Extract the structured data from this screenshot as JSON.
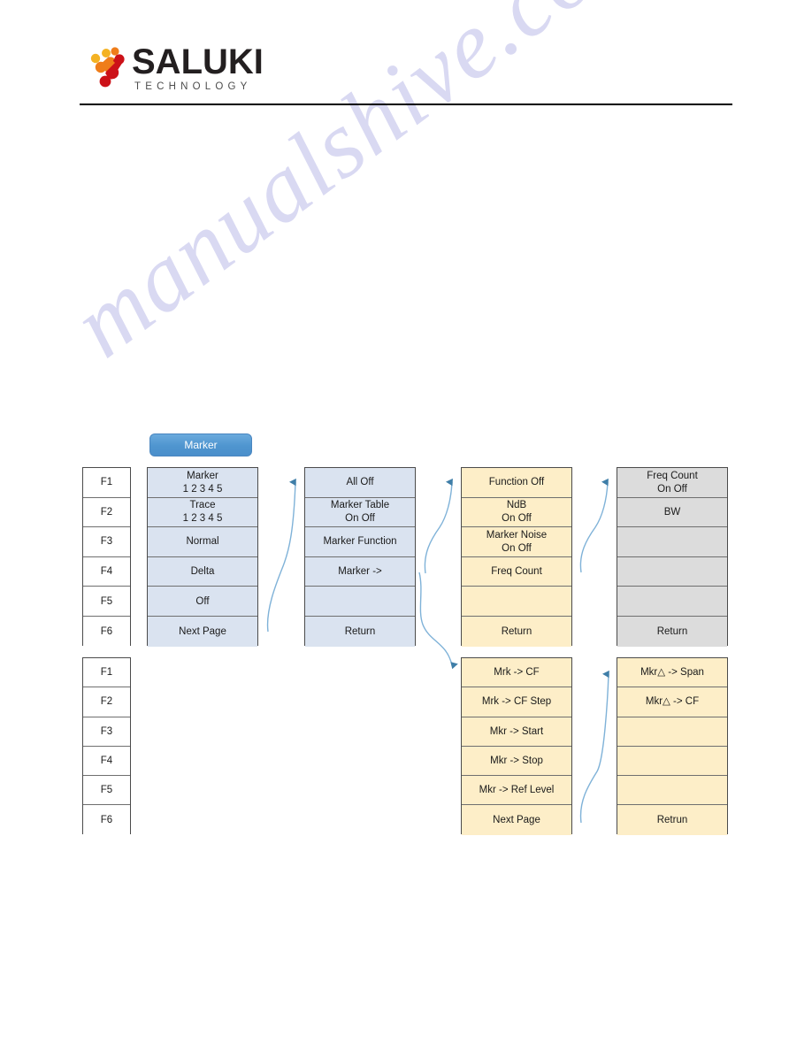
{
  "page": {
    "watermark": "manualshive.com",
    "logo": {
      "name": "SALUKI",
      "tagline": "TECHNOLOGY",
      "colors": {
        "yellow": "#f4b223",
        "orange": "#ef7d1a",
        "red": "#cc1118",
        "text": "#231f20"
      }
    }
  },
  "diagram": {
    "title_button": {
      "label": "Marker",
      "color": "#4f95cf"
    },
    "fkeys_top": {
      "items": [
        "F1",
        "F2",
        "F3",
        "F4",
        "F5",
        "F6"
      ]
    },
    "fkeys_bottom": {
      "items": [
        "F1",
        "F2",
        "F3",
        "F4",
        "F5",
        "F6"
      ]
    },
    "panels": [
      {
        "id": "marker-level1",
        "color": "#dae3f0",
        "rows": [
          {
            "label": "Marker",
            "sub": "1  2  3  4  5"
          },
          {
            "label": "Trace",
            "sub": "1  2  3  4  5"
          },
          {
            "label": "Normal",
            "sub": ""
          },
          {
            "label": "Delta",
            "sub": ""
          },
          {
            "label": "Off",
            "sub": ""
          },
          {
            "label": "Next Page",
            "sub": ""
          }
        ]
      },
      {
        "id": "marker-level2",
        "color": "#dae3f0",
        "rows": [
          {
            "label": "All Off",
            "sub": ""
          },
          {
            "label": "Marker Table",
            "sub": "On      Off"
          },
          {
            "label": "Marker Function",
            "sub": ""
          },
          {
            "label": "Marker ->",
            "sub": ""
          },
          {
            "label": "",
            "sub": ""
          },
          {
            "label": "Return",
            "sub": ""
          }
        ]
      },
      {
        "id": "marker-function",
        "color": "#fdeec8",
        "rows": [
          {
            "label": "Function Off",
            "sub": ""
          },
          {
            "label": "NdB",
            "sub": "On      Off"
          },
          {
            "label": "Marker Noise",
            "sub": "On      Off"
          },
          {
            "label": "Freq Count",
            "sub": ""
          },
          {
            "label": "",
            "sub": ""
          },
          {
            "label": "Return",
            "sub": ""
          }
        ]
      },
      {
        "id": "freq-count",
        "color": "#dcdcdc",
        "rows": [
          {
            "label": "Freq Count",
            "sub": "On      Off"
          },
          {
            "label": "BW",
            "sub": ""
          },
          {
            "label": "",
            "sub": ""
          },
          {
            "label": "",
            "sub": ""
          },
          {
            "label": "",
            "sub": ""
          },
          {
            "label": "Return",
            "sub": ""
          }
        ]
      },
      {
        "id": "marker-to",
        "color": "#fdeec8",
        "rows": [
          {
            "label": "Mrk -> CF",
            "sub": ""
          },
          {
            "label": "Mrk -> CF Step",
            "sub": ""
          },
          {
            "label": "Mkr -> Start",
            "sub": ""
          },
          {
            "label": "Mkr -> Stop",
            "sub": ""
          },
          {
            "label": "Mkr -> Ref Level",
            "sub": ""
          },
          {
            "label": "Next Page",
            "sub": ""
          }
        ]
      },
      {
        "id": "marker-to-page2",
        "color": "#fdeec8",
        "rows": [
          {
            "label": "Mkr△ -> Span",
            "sub": ""
          },
          {
            "label": "Mkr△ -> CF",
            "sub": ""
          },
          {
            "label": "",
            "sub": ""
          },
          {
            "label": "",
            "sub": ""
          },
          {
            "label": "",
            "sub": ""
          },
          {
            "label": "Retrun",
            "sub": ""
          }
        ]
      }
    ],
    "connector_color": "#6fa8d0"
  }
}
